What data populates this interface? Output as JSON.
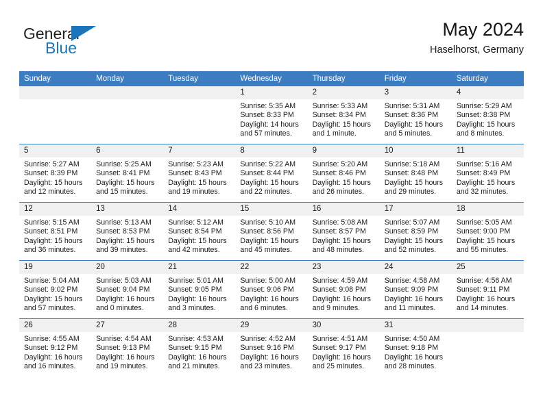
{
  "brand": {
    "name_top": "General",
    "name_bottom": "Blue",
    "accent_color": "#1b75bb"
  },
  "header": {
    "title": "May 2024",
    "subtitle": "Haselhorst, Germany"
  },
  "theme": {
    "header_bg": "#3b7dc0",
    "header_text": "#ffffff",
    "daynum_bg": "#f0f0f0",
    "cell_bg": "#ffffff",
    "text": "#1a1a1a"
  },
  "weekday_headers": [
    "Sunday",
    "Monday",
    "Tuesday",
    "Wednesday",
    "Thursday",
    "Friday",
    "Saturday"
  ],
  "labels": {
    "sunrise": "Sunrise:",
    "sunset": "Sunset:",
    "daylight": "Daylight:"
  },
  "weeks": [
    [
      {
        "day": "",
        "empty": true
      },
      {
        "day": "",
        "empty": true
      },
      {
        "day": "",
        "empty": true
      },
      {
        "day": "1",
        "sunrise": "Sunrise: 5:35 AM",
        "sunset": "Sunset: 8:33 PM",
        "daylight": "Daylight: 14 hours and 57 minutes."
      },
      {
        "day": "2",
        "sunrise": "Sunrise: 5:33 AM",
        "sunset": "Sunset: 8:34 PM",
        "daylight": "Daylight: 15 hours and 1 minute."
      },
      {
        "day": "3",
        "sunrise": "Sunrise: 5:31 AM",
        "sunset": "Sunset: 8:36 PM",
        "daylight": "Daylight: 15 hours and 5 minutes."
      },
      {
        "day": "4",
        "sunrise": "Sunrise: 5:29 AM",
        "sunset": "Sunset: 8:38 PM",
        "daylight": "Daylight: 15 hours and 8 minutes."
      }
    ],
    [
      {
        "day": "5",
        "sunrise": "Sunrise: 5:27 AM",
        "sunset": "Sunset: 8:39 PM",
        "daylight": "Daylight: 15 hours and 12 minutes."
      },
      {
        "day": "6",
        "sunrise": "Sunrise: 5:25 AM",
        "sunset": "Sunset: 8:41 PM",
        "daylight": "Daylight: 15 hours and 15 minutes."
      },
      {
        "day": "7",
        "sunrise": "Sunrise: 5:23 AM",
        "sunset": "Sunset: 8:43 PM",
        "daylight": "Daylight: 15 hours and 19 minutes."
      },
      {
        "day": "8",
        "sunrise": "Sunrise: 5:22 AM",
        "sunset": "Sunset: 8:44 PM",
        "daylight": "Daylight: 15 hours and 22 minutes."
      },
      {
        "day": "9",
        "sunrise": "Sunrise: 5:20 AM",
        "sunset": "Sunset: 8:46 PM",
        "daylight": "Daylight: 15 hours and 26 minutes."
      },
      {
        "day": "10",
        "sunrise": "Sunrise: 5:18 AM",
        "sunset": "Sunset: 8:48 PM",
        "daylight": "Daylight: 15 hours and 29 minutes."
      },
      {
        "day": "11",
        "sunrise": "Sunrise: 5:16 AM",
        "sunset": "Sunset: 8:49 PM",
        "daylight": "Daylight: 15 hours and 32 minutes."
      }
    ],
    [
      {
        "day": "12",
        "sunrise": "Sunrise: 5:15 AM",
        "sunset": "Sunset: 8:51 PM",
        "daylight": "Daylight: 15 hours and 36 minutes."
      },
      {
        "day": "13",
        "sunrise": "Sunrise: 5:13 AM",
        "sunset": "Sunset: 8:53 PM",
        "daylight": "Daylight: 15 hours and 39 minutes."
      },
      {
        "day": "14",
        "sunrise": "Sunrise: 5:12 AM",
        "sunset": "Sunset: 8:54 PM",
        "daylight": "Daylight: 15 hours and 42 minutes."
      },
      {
        "day": "15",
        "sunrise": "Sunrise: 5:10 AM",
        "sunset": "Sunset: 8:56 PM",
        "daylight": "Daylight: 15 hours and 45 minutes."
      },
      {
        "day": "16",
        "sunrise": "Sunrise: 5:08 AM",
        "sunset": "Sunset: 8:57 PM",
        "daylight": "Daylight: 15 hours and 48 minutes."
      },
      {
        "day": "17",
        "sunrise": "Sunrise: 5:07 AM",
        "sunset": "Sunset: 8:59 PM",
        "daylight": "Daylight: 15 hours and 52 minutes."
      },
      {
        "day": "18",
        "sunrise": "Sunrise: 5:05 AM",
        "sunset": "Sunset: 9:00 PM",
        "daylight": "Daylight: 15 hours and 55 minutes."
      }
    ],
    [
      {
        "day": "19",
        "sunrise": "Sunrise: 5:04 AM",
        "sunset": "Sunset: 9:02 PM",
        "daylight": "Daylight: 15 hours and 57 minutes."
      },
      {
        "day": "20",
        "sunrise": "Sunrise: 5:03 AM",
        "sunset": "Sunset: 9:04 PM",
        "daylight": "Daylight: 16 hours and 0 minutes."
      },
      {
        "day": "21",
        "sunrise": "Sunrise: 5:01 AM",
        "sunset": "Sunset: 9:05 PM",
        "daylight": "Daylight: 16 hours and 3 minutes."
      },
      {
        "day": "22",
        "sunrise": "Sunrise: 5:00 AM",
        "sunset": "Sunset: 9:06 PM",
        "daylight": "Daylight: 16 hours and 6 minutes."
      },
      {
        "day": "23",
        "sunrise": "Sunrise: 4:59 AM",
        "sunset": "Sunset: 9:08 PM",
        "daylight": "Daylight: 16 hours and 9 minutes."
      },
      {
        "day": "24",
        "sunrise": "Sunrise: 4:58 AM",
        "sunset": "Sunset: 9:09 PM",
        "daylight": "Daylight: 16 hours and 11 minutes."
      },
      {
        "day": "25",
        "sunrise": "Sunrise: 4:56 AM",
        "sunset": "Sunset: 9:11 PM",
        "daylight": "Daylight: 16 hours and 14 minutes."
      }
    ],
    [
      {
        "day": "26",
        "sunrise": "Sunrise: 4:55 AM",
        "sunset": "Sunset: 9:12 PM",
        "daylight": "Daylight: 16 hours and 16 minutes."
      },
      {
        "day": "27",
        "sunrise": "Sunrise: 4:54 AM",
        "sunset": "Sunset: 9:13 PM",
        "daylight": "Daylight: 16 hours and 19 minutes."
      },
      {
        "day": "28",
        "sunrise": "Sunrise: 4:53 AM",
        "sunset": "Sunset: 9:15 PM",
        "daylight": "Daylight: 16 hours and 21 minutes."
      },
      {
        "day": "29",
        "sunrise": "Sunrise: 4:52 AM",
        "sunset": "Sunset: 9:16 PM",
        "daylight": "Daylight: 16 hours and 23 minutes."
      },
      {
        "day": "30",
        "sunrise": "Sunrise: 4:51 AM",
        "sunset": "Sunset: 9:17 PM",
        "daylight": "Daylight: 16 hours and 25 minutes."
      },
      {
        "day": "31",
        "sunrise": "Sunrise: 4:50 AM",
        "sunset": "Sunset: 9:18 PM",
        "daylight": "Daylight: 16 hours and 28 minutes."
      },
      {
        "day": "",
        "empty": true
      }
    ]
  ]
}
